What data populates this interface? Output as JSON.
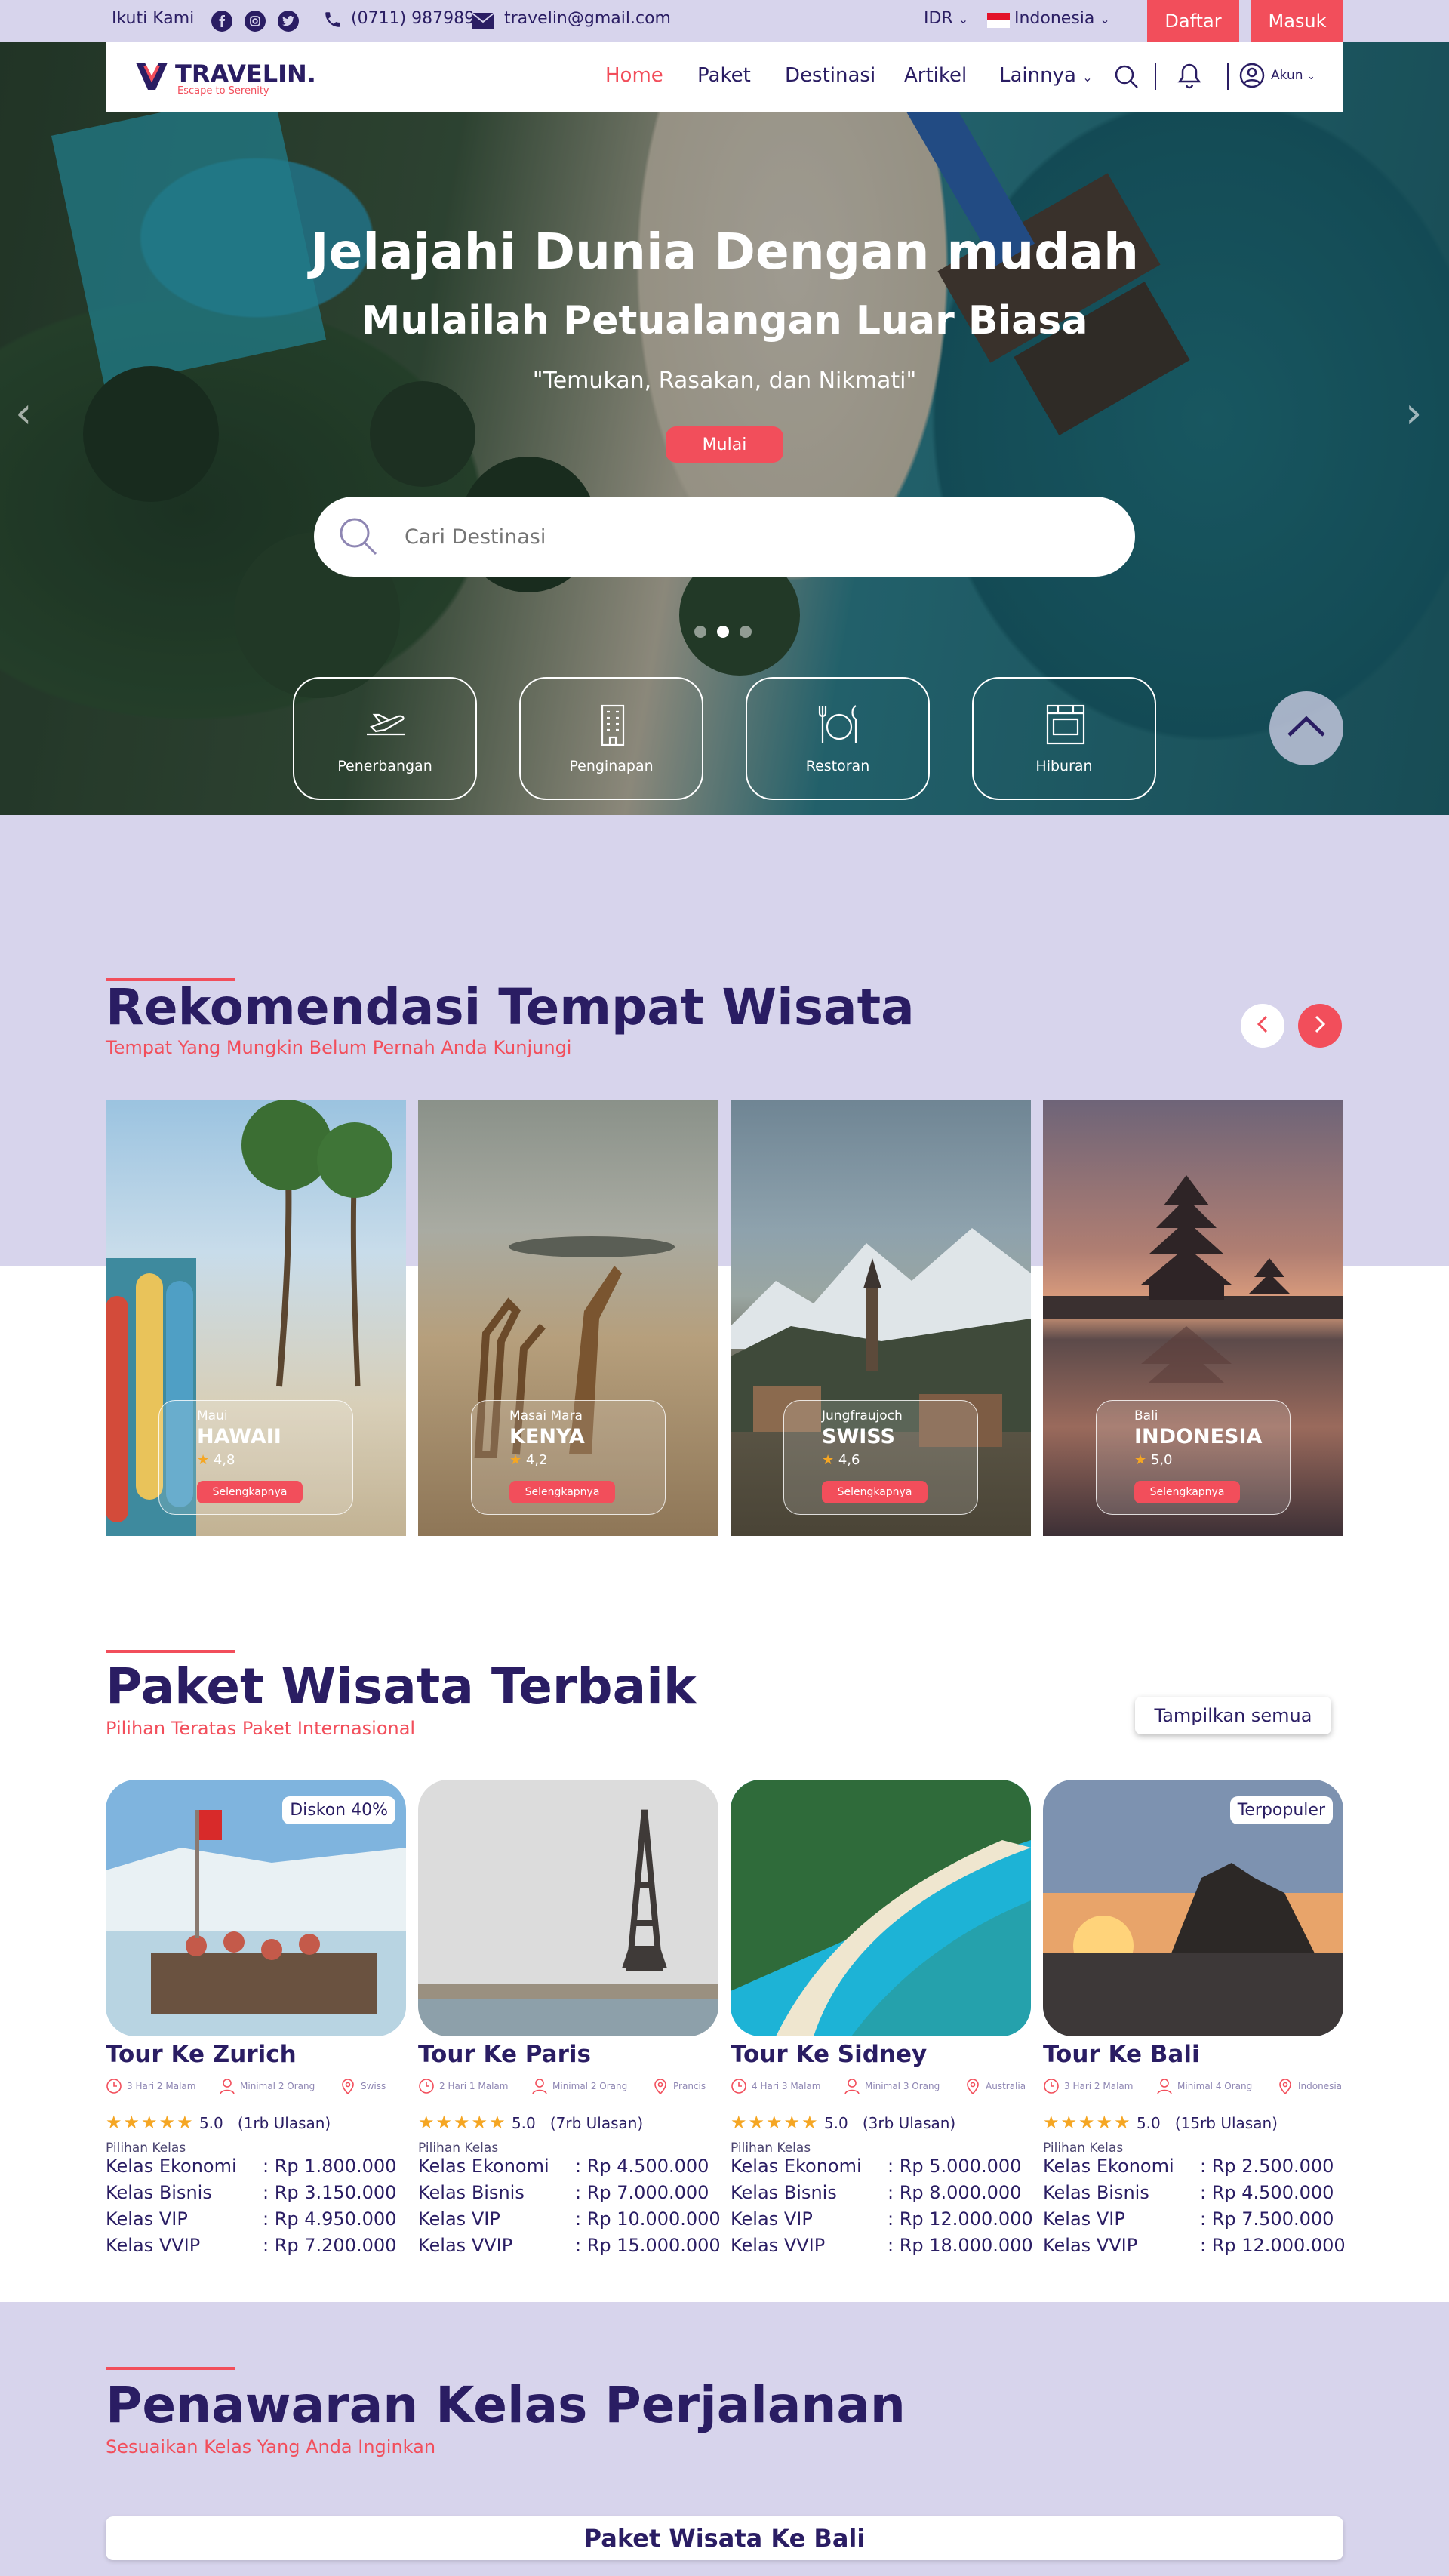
{
  "topbar": {
    "follow": "Ikuti Kami",
    "phone": "(0711) 987989",
    "email": "travelin@gmail.com",
    "currency": "IDR",
    "language": "Indonesia",
    "register": "Daftar",
    "login": "Masuk"
  },
  "nav": {
    "brand": "TRAVELIN.",
    "tagline": "Escape to Serenity",
    "items": [
      "Home",
      "Paket",
      "Destinasi",
      "Artikel",
      "Lainnya"
    ],
    "account": "Akun"
  },
  "hero": {
    "title": "Jelajahi Dunia Dengan mudah",
    "subtitle": "Mulailah Petualangan Luar Biasa",
    "quote": "\"Temukan, Rasakan, dan Nikmati\"",
    "cta": "Mulai",
    "search_placeholder": "Cari Destinasi",
    "categories": [
      "Penerbangan",
      "Penginapan",
      "Restoran",
      "Hiburan"
    ]
  },
  "recommend": {
    "title": "Rekomendasi Tempat Wisata",
    "subtitle": "Tempat Yang Mungkin Belum Pernah Anda Kunjungi",
    "cards": [
      {
        "region": "Maui",
        "country": "HAWAII",
        "rating": "4,8",
        "button": "Selengkapnya"
      },
      {
        "region": "Masai Mara",
        "country": "KENYA",
        "rating": "4,2",
        "button": "Selengkapnya"
      },
      {
        "region": "Jungfraujoch",
        "country": "SWISS",
        "rating": "4,6",
        "button": "Selengkapnya"
      },
      {
        "region": "Bali",
        "country": "INDONESIA",
        "rating": "5,0",
        "button": "Selengkapnya"
      }
    ]
  },
  "packages": {
    "title": "Paket Wisata Terbaik",
    "subtitle": "Pilihan Teratas Paket Internasional",
    "show_all": "Tampilkan semua",
    "class_label": "Pilihan Kelas",
    "cards": [
      {
        "name": "Tour Ke Zurich",
        "badge": "Diskon 40%",
        "duration": "3 Hari 2 Malam",
        "min": "Minimal 2 Orang",
        "place": "Swiss",
        "score": "5.0",
        "reviews": "(1rb Ulasan)",
        "classes": [
          [
            "Kelas Ekonomi",
            ": Rp 1.800.000"
          ],
          [
            "Kelas Bisnis",
            ": Rp 3.150.000"
          ],
          [
            "Kelas VIP",
            ": Rp 4.950.000"
          ],
          [
            "Kelas VVIP",
            ": Rp 7.200.000"
          ]
        ]
      },
      {
        "name": "Tour Ke Paris",
        "badge": "",
        "duration": "2 Hari 1 Malam",
        "min": "Minimal 2 Orang",
        "place": "Prancis",
        "score": "5.0",
        "reviews": "(7rb Ulasan)",
        "classes": [
          [
            "Kelas Ekonomi",
            ": Rp 4.500.000"
          ],
          [
            "Kelas Bisnis",
            ": Rp 7.000.000"
          ],
          [
            "Kelas VIP",
            ": Rp 10.000.000"
          ],
          [
            "Kelas VVIP",
            ": Rp 15.000.000"
          ]
        ]
      },
      {
        "name": "Tour Ke Sidney",
        "badge": "",
        "duration": "4 Hari 3 Malam",
        "min": "Minimal 3 Orang",
        "place": "Australia",
        "score": "5.0",
        "reviews": "(3rb Ulasan)",
        "classes": [
          [
            "Kelas Ekonomi",
            ": Rp 5.000.000"
          ],
          [
            "Kelas Bisnis",
            ": Rp 8.000.000"
          ],
          [
            "Kelas VIP",
            ": Rp 12.000.000"
          ],
          [
            "Kelas VVIP",
            ": Rp 18.000.000"
          ]
        ]
      },
      {
        "name": "Tour Ke Bali",
        "badge": "Terpopuler",
        "duration": "3 Hari 2 Malam",
        "min": "Minimal 4 Orang",
        "place": "Indonesia",
        "score": "5.0",
        "reviews": "(15rb Ulasan)",
        "classes": [
          [
            "Kelas Ekonomi",
            ": Rp 2.500.000"
          ],
          [
            "Kelas Bisnis",
            ": Rp 4.500.000"
          ],
          [
            "Kelas VIP",
            ": Rp 7.500.000"
          ],
          [
            "Kelas VVIP",
            ": Rp 12.000.000"
          ]
        ]
      }
    ]
  },
  "offers": {
    "title": "Penawaran Kelas Perjalanan",
    "subtitle": "Sesuaikan Kelas Yang Anda Inginkan",
    "tab": "Paket Wisata Ke Bali"
  },
  "colors": {
    "primary": "#2a1d63",
    "accent": "#f24e5b",
    "lavender": "#d7d4ec",
    "star": "#f5a623"
  }
}
